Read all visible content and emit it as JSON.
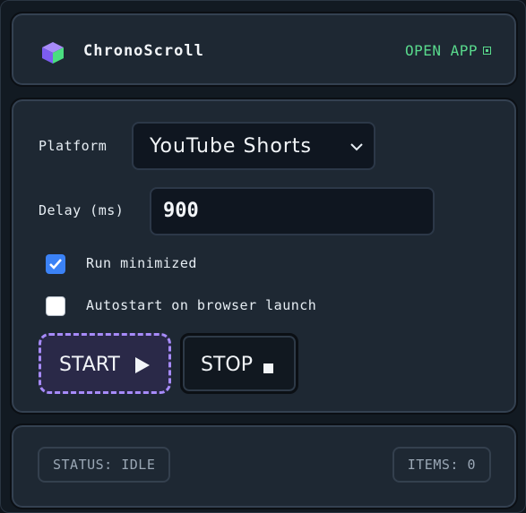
{
  "header": {
    "app_name": "ChronoScroll",
    "open_app_label": "OPEN APP",
    "logo_icon": "cube-logo-icon"
  },
  "form": {
    "platform_label": "Platform",
    "platform_value": "YouTube Shorts",
    "delay_label": "Delay (ms)",
    "delay_value": "900",
    "run_minimized_label": "Run minimized",
    "run_minimized_checked": true,
    "autostart_label": "Autostart on browser launch",
    "autostart_checked": false
  },
  "actions": {
    "start_label": "START",
    "start_icon": "play-icon",
    "stop_label": "STOP",
    "stop_icon": "stop-square-icon"
  },
  "footer": {
    "status_text": "STATUS: IDLE",
    "items_text": "ITEMS: 0"
  },
  "colors": {
    "accent_green": "#59d98c",
    "accent_purple": "#a78bfa",
    "checkbox_blue": "#3b82f6"
  }
}
